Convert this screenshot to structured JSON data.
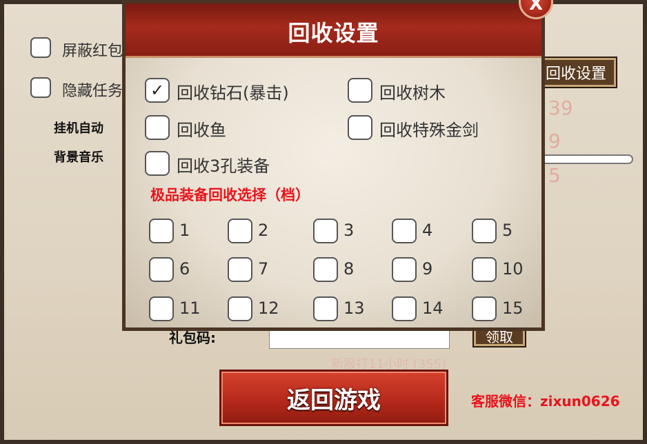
{
  "background": {
    "left_options": [
      {
        "label": "屏蔽红包",
        "checked": false
      },
      {
        "label": "隐藏任务",
        "checked": false
      }
    ],
    "auto_label": "挂机自动",
    "music_label": "背景音乐",
    "recycle_settings_button": "回收设置",
    "faded_numbers": [
      "39",
      "9",
      "5"
    ],
    "gift_code_label": "礼包码:",
    "claim_button": "领取",
    "faded_row": "新服打11小时 (355)",
    "return_button": "返回游戏",
    "service_text": "客服微信：zixun0626"
  },
  "modal": {
    "title": "回收设置",
    "close_label": "X",
    "options": [
      {
        "label": "回收钻石(暴击)",
        "checked": true
      },
      {
        "label": "回收树木",
        "checked": false
      },
      {
        "label": "回收鱼",
        "checked": false
      },
      {
        "label": "回收特殊金剑",
        "checked": false
      },
      {
        "label": "回收3孔装备",
        "checked": false
      }
    ],
    "premium_title": "极品装备回收选择（档）",
    "tiers": [
      "1",
      "2",
      "3",
      "4",
      "5",
      "6",
      "7",
      "8",
      "9",
      "10",
      "11",
      "12",
      "13",
      "14",
      "15"
    ],
    "checkmark": "✓"
  }
}
